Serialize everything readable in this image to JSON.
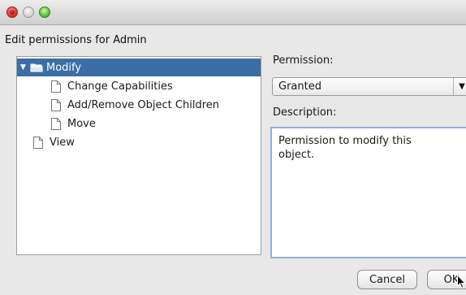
{
  "dialog": {
    "heading": "Edit permissions for Admin"
  },
  "tree": {
    "items": [
      {
        "label": "Modify"
      },
      {
        "label": "Change Capabilities"
      },
      {
        "label": "Add/Remove Object Children"
      },
      {
        "label": "Move"
      },
      {
        "label": "View"
      }
    ]
  },
  "permission": {
    "label": "Permission:",
    "selected": "Granted"
  },
  "description": {
    "label": "Description:",
    "text": "Permission to modify this object."
  },
  "buttons": {
    "cancel": "Cancel",
    "ok": "OK"
  },
  "colors": {
    "selection": "#3b6ea5",
    "focus_border": "#8fb2d8"
  }
}
